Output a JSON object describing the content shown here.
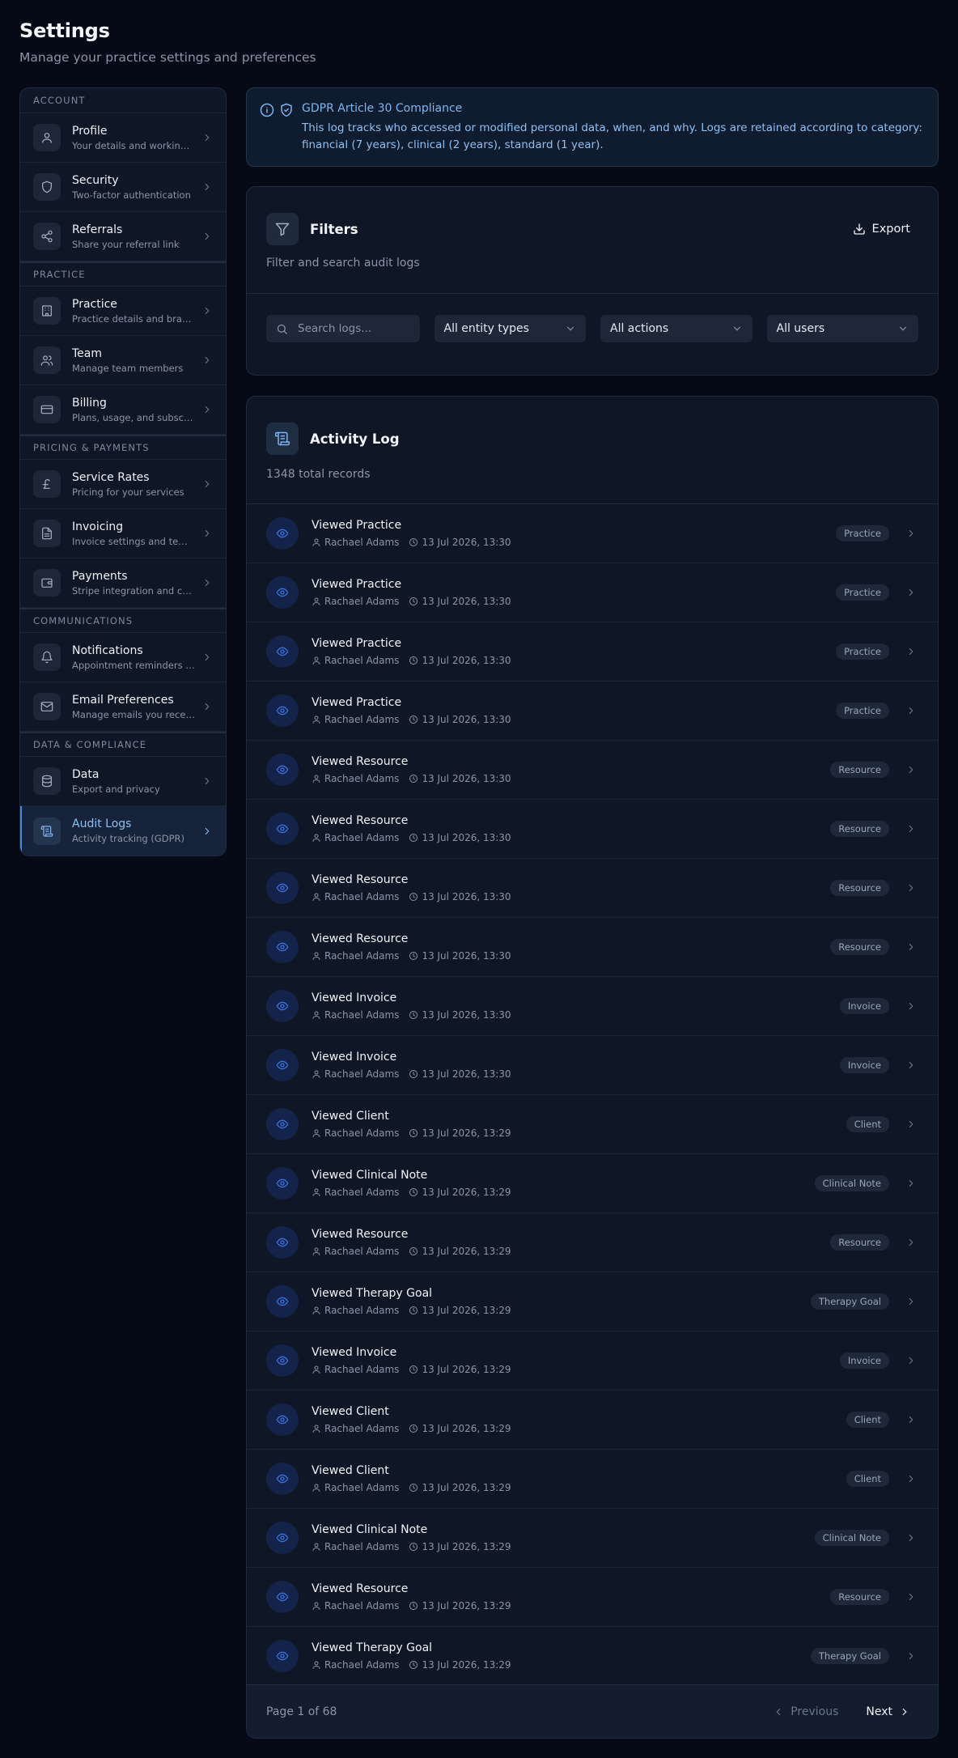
{
  "header": {
    "title": "Settings",
    "subtitle": "Manage your practice settings and preferences"
  },
  "sidebar": {
    "sections": [
      {
        "title": "ACCOUNT",
        "items": [
          {
            "label": "Profile",
            "desc": "Your details and working hours",
            "icon": "user-icon"
          },
          {
            "label": "Security",
            "desc": "Two-factor authentication",
            "icon": "shield-icon"
          },
          {
            "label": "Referrals",
            "desc": "Share your referral link",
            "icon": "share-icon"
          }
        ]
      },
      {
        "title": "PRACTICE",
        "items": [
          {
            "label": "Practice",
            "desc": "Practice details and branding",
            "icon": "building-icon"
          },
          {
            "label": "Team",
            "desc": "Manage team members",
            "icon": "users-icon"
          },
          {
            "label": "Billing",
            "desc": "Plans, usage, and subscriptions",
            "icon": "credit-card-icon"
          }
        ]
      },
      {
        "title": "PRICING & PAYMENTS",
        "items": [
          {
            "label": "Service Rates",
            "desc": "Pricing for your services",
            "icon": "pound-icon"
          },
          {
            "label": "Invoicing",
            "desc": "Invoice settings and templates",
            "icon": "document-icon"
          },
          {
            "label": "Payments",
            "desc": "Stripe integration and card payments",
            "icon": "wallet-icon"
          }
        ]
      },
      {
        "title": "COMMUNICATIONS",
        "items": [
          {
            "label": "Notifications",
            "desc": "Appointment reminders and alerts",
            "icon": "bell-icon"
          },
          {
            "label": "Email Preferences",
            "desc": "Manage emails you receive",
            "icon": "mail-icon"
          }
        ]
      },
      {
        "title": "DATA & COMPLIANCE",
        "items": [
          {
            "label": "Data",
            "desc": "Export and privacy",
            "icon": "database-icon"
          },
          {
            "label": "Audit Logs",
            "desc": "Activity tracking (GDPR)",
            "icon": "scroll-icon",
            "active": true
          }
        ]
      }
    ]
  },
  "notice": {
    "title": "GDPR Article 30 Compliance",
    "text": "This log tracks who accessed or modified personal data, when, and why. Logs are retained according to category: financial (7 years), clinical (2 years), standard (1 year)."
  },
  "filters": {
    "title": "Filters",
    "subtitle": "Filter and search audit logs",
    "export_label": "Export",
    "search_placeholder": "Search logs...",
    "entity_select": "All entity types",
    "action_select": "All actions",
    "user_select": "All users"
  },
  "activity": {
    "title": "Activity Log",
    "subtitle": "1348 total records",
    "rows": [
      {
        "title": "Viewed Practice",
        "user": "Rachael Adams",
        "time": "13 Jul 2026, 13:30",
        "badge": "Practice"
      },
      {
        "title": "Viewed Practice",
        "user": "Rachael Adams",
        "time": "13 Jul 2026, 13:30",
        "badge": "Practice"
      },
      {
        "title": "Viewed Practice",
        "user": "Rachael Adams",
        "time": "13 Jul 2026, 13:30",
        "badge": "Practice"
      },
      {
        "title": "Viewed Practice",
        "user": "Rachael Adams",
        "time": "13 Jul 2026, 13:30",
        "badge": "Practice"
      },
      {
        "title": "Viewed Resource",
        "user": "Rachael Adams",
        "time": "13 Jul 2026, 13:30",
        "badge": "Resource"
      },
      {
        "title": "Viewed Resource",
        "user": "Rachael Adams",
        "time": "13 Jul 2026, 13:30",
        "badge": "Resource"
      },
      {
        "title": "Viewed Resource",
        "user": "Rachael Adams",
        "time": "13 Jul 2026, 13:30",
        "badge": "Resource"
      },
      {
        "title": "Viewed Resource",
        "user": "Rachael Adams",
        "time": "13 Jul 2026, 13:30",
        "badge": "Resource"
      },
      {
        "title": "Viewed Invoice",
        "user": "Rachael Adams",
        "time": "13 Jul 2026, 13:30",
        "badge": "Invoice"
      },
      {
        "title": "Viewed Invoice",
        "user": "Rachael Adams",
        "time": "13 Jul 2026, 13:30",
        "badge": "Invoice"
      },
      {
        "title": "Viewed Client",
        "user": "Rachael Adams",
        "time": "13 Jul 2026, 13:29",
        "badge": "Client"
      },
      {
        "title": "Viewed Clinical Note",
        "user": "Rachael Adams",
        "time": "13 Jul 2026, 13:29",
        "badge": "Clinical Note"
      },
      {
        "title": "Viewed Resource",
        "user": "Rachael Adams",
        "time": "13 Jul 2026, 13:29",
        "badge": "Resource"
      },
      {
        "title": "Viewed Therapy Goal",
        "user": "Rachael Adams",
        "time": "13 Jul 2026, 13:29",
        "badge": "Therapy Goal"
      },
      {
        "title": "Viewed Invoice",
        "user": "Rachael Adams",
        "time": "13 Jul 2026, 13:29",
        "badge": "Invoice"
      },
      {
        "title": "Viewed Client",
        "user": "Rachael Adams",
        "time": "13 Jul 2026, 13:29",
        "badge": "Client"
      },
      {
        "title": "Viewed Client",
        "user": "Rachael Adams",
        "time": "13 Jul 2026, 13:29",
        "badge": "Client"
      },
      {
        "title": "Viewed Clinical Note",
        "user": "Rachael Adams",
        "time": "13 Jul 2026, 13:29",
        "badge": "Clinical Note"
      },
      {
        "title": "Viewed Resource",
        "user": "Rachael Adams",
        "time": "13 Jul 2026, 13:29",
        "badge": "Resource"
      },
      {
        "title": "Viewed Therapy Goal",
        "user": "Rachael Adams",
        "time": "13 Jul 2026, 13:29",
        "badge": "Therapy Goal"
      }
    ],
    "pagination": {
      "info": "Page 1 of 68",
      "prev_label": "Previous",
      "next_label": "Next"
    }
  },
  "colors": {
    "background": "#050a16",
    "card": "#0f1726",
    "accent": "#7eb6f0",
    "eye_icon": "#3b72e0"
  }
}
